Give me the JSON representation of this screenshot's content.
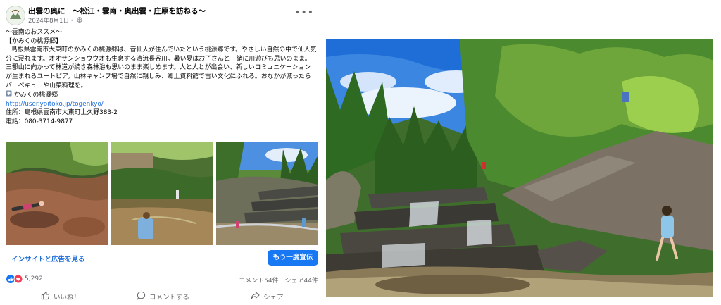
{
  "post": {
    "page_name": "出雲の奥に　～松江・雲南・奥出雲・庄原を訪ねる～",
    "date": "2024年8月1日・",
    "heading1": "～雲南のおススメ～",
    "heading2": "【かみくの桃源郷】",
    "body_text": "島根県雲南市大東町のかみくの桃源郷は、昔仙人が住んでいたという桃源郷です。やさしい自然の中で仙人気分に浸れます。オオサンショウウオも生息する清流長谷川。暑い夏はお子さんと一緒に川遊びも思いのまま。三郡山に向かって林道が続き森林浴も思いのまま楽しめます。人と人とが出会い、新しいコミュニケーションが生まれるユートピア。山林キャンプ場で自然に親しみ、郷土資料館で古い文化にふれる。おなかが減ったらバーベキューや山菜料理を。",
    "place_name": "かみくの桃源郷",
    "url": "http://user.yoitoko.jp/togenkyo/",
    "address": "住所：島根県雲南市大東町上久野383-2",
    "phone": "電話：080-3714-9877"
  },
  "insight_label": "インサイトと広告を見る",
  "boost_label": "もう一度宣伝",
  "stats": {
    "reactions": "5,292",
    "comments_shares": "コメント54件　シェア44件"
  },
  "actions": {
    "like": "いいね！",
    "comment": "コメントする",
    "share": "シェア"
  },
  "colors": {
    "link": "#216fdb",
    "button": "#1877f2",
    "like_blue": "#1877f2",
    "love_red": "#f33e58"
  },
  "icons": [
    "more-options-icon",
    "globe-icon",
    "map-pin-icon",
    "like-reaction-icon",
    "love-reaction-icon",
    "thumbs-up-icon",
    "comment-icon",
    "share-icon"
  ]
}
